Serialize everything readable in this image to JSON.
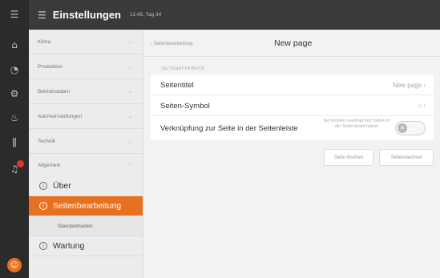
{
  "rail": {
    "icons": [
      "menu-icon",
      "home-icon",
      "dashboard-icon",
      "production-icon",
      "alarm-icon",
      "thermometer-icon",
      "notification-icon",
      "avatar"
    ],
    "badge_color": "#e0352b"
  },
  "topbar": {
    "title": "Einstellungen",
    "time": "12:45, Tag 34"
  },
  "sidebar": {
    "items": [
      {
        "label": "Klima"
      },
      {
        "label": "Produktion"
      },
      {
        "label": "Betriebsdaten"
      },
      {
        "label": "Alarmeinstellungen"
      },
      {
        "label": "Technik"
      },
      {
        "label": "Allgemein"
      }
    ],
    "sub": {
      "about": "Über",
      "page_edit": "Seitenbearbeitung",
      "standard_page": "Standardseiten",
      "maintenance": "Wartung"
    }
  },
  "main": {
    "back_label": "Seitenbearbeitung",
    "title": "New page",
    "section_label": "SEITENATTRIBUTE",
    "rows": {
      "title_label": "Seitentitel",
      "title_value": "New page",
      "symbol_label": "Seiten-Symbol",
      "link_label": "Verknüpfung zur Seite in der Seitenleiste",
      "link_note": "Sie können maximal fünf Seiten in der Seitenleiste haben"
    },
    "toggle_state": "off",
    "buttons": {
      "delete": "Seite löschen",
      "switch": "Seitenwechsel"
    }
  },
  "colors": {
    "accent": "#e8711f",
    "rail_bg": "#2b2b2b",
    "topbar_bg": "#3a3a3a"
  }
}
